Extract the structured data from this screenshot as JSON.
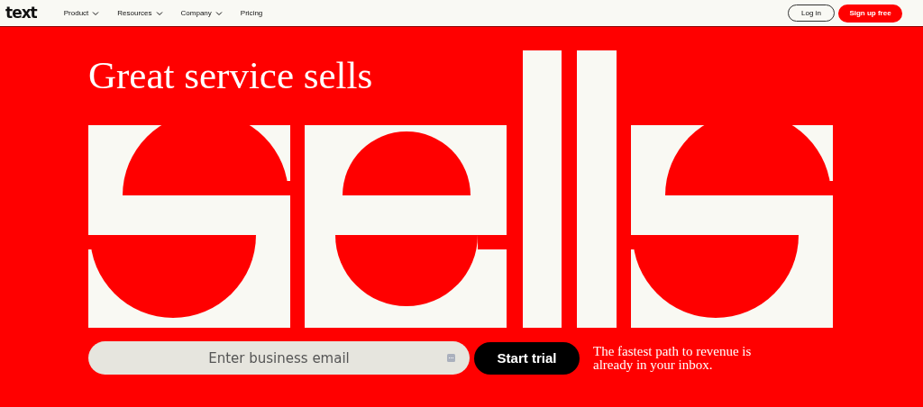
{
  "nav": {
    "logo": "text",
    "links": [
      {
        "label": "Product",
        "dropdown": true
      },
      {
        "label": "Resources",
        "dropdown": true
      },
      {
        "label": "Company",
        "dropdown": true
      },
      {
        "label": "Pricing",
        "dropdown": false
      }
    ],
    "login": "Log in",
    "signup": "Sign up free"
  },
  "hero": {
    "headline": "Great service sells",
    "email": {
      "placeholder": "Enter business email"
    },
    "cta": "Start trial",
    "tagline": "The fastest path to revenue is already in your inbox."
  }
}
